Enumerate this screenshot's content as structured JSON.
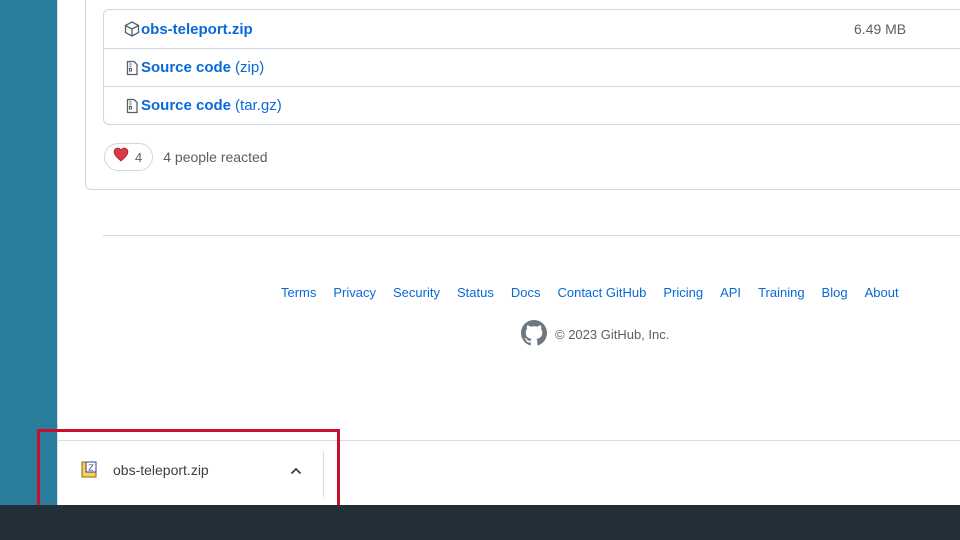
{
  "assets": [
    {
      "name": "obs-teleport.zip",
      "suffix": "",
      "size": "6.49 MB",
      "icon": "package-icon"
    },
    {
      "name": "Source code",
      "suffix": "(zip)",
      "size": "",
      "icon": "file-zip-icon"
    },
    {
      "name": "Source code",
      "suffix": "(tar.gz)",
      "size": "",
      "icon": "file-zip-icon"
    }
  ],
  "reactions": {
    "count": "4",
    "summary": "4 people reacted"
  },
  "footer": {
    "links": [
      "Terms",
      "Privacy",
      "Security",
      "Status",
      "Docs",
      "Contact GitHub",
      "Pricing",
      "API",
      "Training",
      "Blog",
      "About"
    ],
    "copyright": "© 2023 GitHub, Inc."
  },
  "download": {
    "filename": "obs-teleport.zip"
  },
  "colors": {
    "link": "#0969da",
    "highlight": "#c8102e",
    "taskbar": "#222f37",
    "left_strip": "#2a7e9b"
  }
}
